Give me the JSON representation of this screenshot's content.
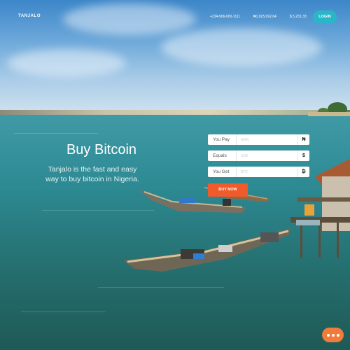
{
  "header": {
    "logo": "TANJALO",
    "phone": "+234-906-000-1111",
    "ngn_price": "₦1,925,092.64",
    "usd_price": "$ 5,231.33",
    "login_label": "LOGIN"
  },
  "hero": {
    "title": "Buy Bitcoin",
    "subtitle": "Tanjalo is the fast and easy way to buy bitcoin in Nigeria."
  },
  "form": {
    "rows": [
      {
        "label": "You Pay",
        "placeholder": "NGN",
        "symbol": "₦"
      },
      {
        "label": "Equals",
        "placeholder": "USD",
        "symbol": "$"
      },
      {
        "label": "You Get",
        "placeholder": "BTC",
        "symbol": "₿"
      }
    ],
    "submit_label": "BUY NOW"
  },
  "colors": {
    "accent_orange": "#f15a2b",
    "login_teal": "#29b6c9",
    "chat_orange": "#f07b3a"
  },
  "icons": {
    "chat": "ellipsis-chat-icon"
  }
}
